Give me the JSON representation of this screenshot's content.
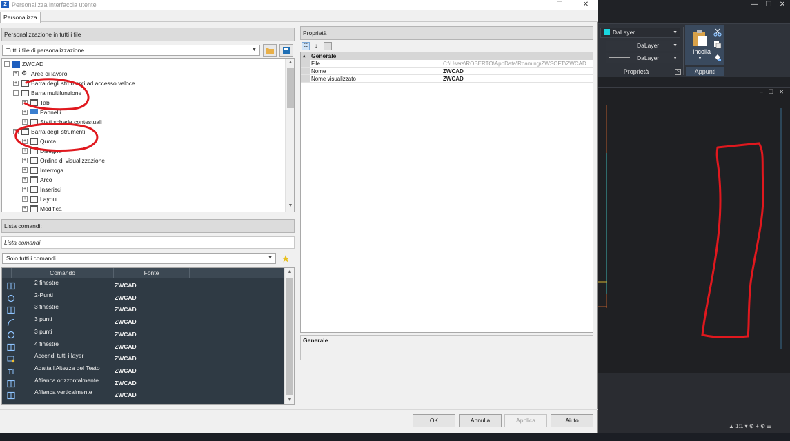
{
  "dialog": {
    "title": "Personalizza interfaccia utente",
    "tab": "Personalizza",
    "left_header": "Personalizzazione in tutti i file",
    "file_combo": "Tutti i file di personalizzazione",
    "tree": [
      {
        "label": "ZWCAD",
        "level": 0,
        "icon": "zwcad-logo-icon"
      },
      {
        "label": "Aree di lavoro",
        "level": 1,
        "icon": "gears-icon"
      },
      {
        "label": "Barra degli strumenti ad accesso veloce",
        "level": 1,
        "icon": "toolbar-icon"
      },
      {
        "label": "Barra multifunzione",
        "level": 1,
        "icon": "ribbon-icon"
      },
      {
        "label": "Tab",
        "level": 2,
        "icon": "tab-icon"
      },
      {
        "label": "Pannelli",
        "level": 2,
        "icon": "panels-icon"
      },
      {
        "label": "Stati schede contestuali",
        "level": 2,
        "icon": "context-icon"
      },
      {
        "label": "Barra degli strumenti",
        "level": 1,
        "icon": "toolbar-icon"
      },
      {
        "label": "Quota",
        "level": 2,
        "icon": "toolbar-icon"
      },
      {
        "label": "Disegna",
        "level": 2,
        "icon": "toolbar-icon"
      },
      {
        "label": "Ordine di visualizzazione",
        "level": 2,
        "icon": "toolbar-icon"
      },
      {
        "label": "Interroga",
        "level": 2,
        "icon": "toolbar-icon"
      },
      {
        "label": "Arco",
        "level": 2,
        "icon": "toolbar-icon"
      },
      {
        "label": "Inserisci",
        "level": 2,
        "icon": "toolbar-icon"
      },
      {
        "label": "Layout",
        "level": 2,
        "icon": "toolbar-icon"
      },
      {
        "label": "Modifica",
        "level": 2,
        "icon": "toolbar-icon"
      }
    ],
    "cmd_header": "Lista comandi:",
    "cmd_filter": "Lista comandi",
    "cmd_combo": "Solo tutti i comandi",
    "cmd_columns": {
      "command": "Comando",
      "source": "Fonte"
    },
    "commands": [
      {
        "name": "2 finestre",
        "source": "ZWCAD",
        "icon": "two-viewports-icon"
      },
      {
        "name": "2-Punti",
        "source": "ZWCAD",
        "icon": "circle-icon"
      },
      {
        "name": "3 finestre",
        "source": "ZWCAD",
        "icon": "three-viewports-icon"
      },
      {
        "name": "3 punti",
        "source": "ZWCAD",
        "icon": "arc-icon"
      },
      {
        "name": "3 punti",
        "source": "ZWCAD",
        "icon": "circle-icon"
      },
      {
        "name": "4 finestre",
        "source": "ZWCAD",
        "icon": "four-viewports-icon"
      },
      {
        "name": "Accendi tutti i layer",
        "source": "ZWCAD",
        "icon": "layer-on-icon"
      },
      {
        "name": "Adatta l'Altezza del Testo",
        "source": "ZWCAD",
        "icon": "text-height-icon"
      },
      {
        "name": "Affianca orizzontalmente",
        "source": "ZWCAD",
        "icon": "tile-horizontal-icon"
      },
      {
        "name": "Affianca verticalmente",
        "source": "ZWCAD",
        "icon": "tile-vertical-icon"
      }
    ],
    "props_header": "Proprietà",
    "props_group": "Generale",
    "props": [
      {
        "key": "File",
        "value": "C:\\Users\\ROBERTO\\AppData\\Roaming\\ZWSOFT\\ZWCAD"
      },
      {
        "key": "Nome",
        "value": "ZWCAD"
      },
      {
        "key": "Nome visualizzato",
        "value": "ZWCAD"
      }
    ],
    "desc_title": "Generale",
    "buttons": {
      "ok": "OK",
      "cancel": "Annulla",
      "apply": "Applica",
      "help": "Aiuto"
    }
  },
  "cad": {
    "layer_combo": "DaLayer",
    "linetype_combo": "DaLayer",
    "lineweight_combo": "DaLayer",
    "properties_label": "Proprietà",
    "paste_label": "Incolla",
    "clipboard_label": "Appunti"
  },
  "colors": {
    "annotation": "#e0181e",
    "cmd_bg": "#2f3a44",
    "accent_cyan": "#19d7e0"
  }
}
